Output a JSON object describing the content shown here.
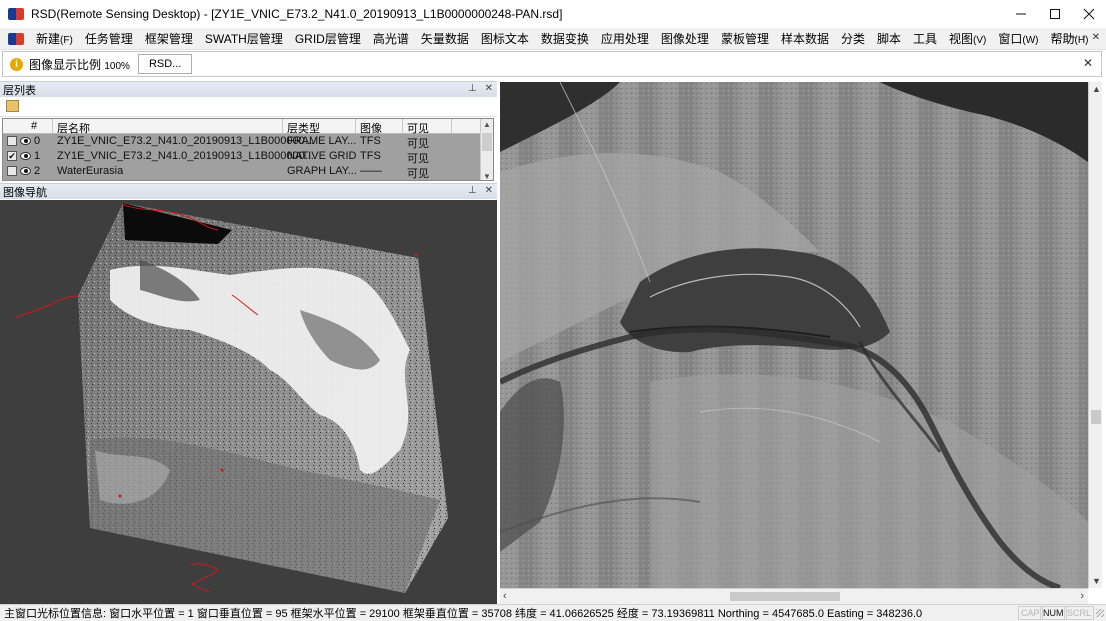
{
  "window": {
    "title": "RSD(Remote Sensing Desktop) - [ZY1E_VNIC_E73.2_N41.0_20190913_L1B0000000248-PAN.rsd]",
    "controls": [
      "minimize-icon",
      "maximize-icon",
      "close-icon"
    ]
  },
  "menubar": {
    "items": [
      {
        "label": "新建",
        "accel": "(F)"
      },
      {
        "label": "任务管理",
        "accel": ""
      },
      {
        "label": "框架管理",
        "accel": ""
      },
      {
        "label": "SWATH层管理",
        "accel": ""
      },
      {
        "label": "GRID层管理",
        "accel": ""
      },
      {
        "label": "高光谱",
        "accel": ""
      },
      {
        "label": "矢量数据",
        "accel": ""
      },
      {
        "label": "图标文本",
        "accel": ""
      },
      {
        "label": "数据变换",
        "accel": ""
      },
      {
        "label": "应用处理",
        "accel": ""
      },
      {
        "label": "图像处理",
        "accel": ""
      },
      {
        "label": "蒙板管理",
        "accel": ""
      },
      {
        "label": "样本数据",
        "accel": ""
      },
      {
        "label": "分类",
        "accel": ""
      },
      {
        "label": "脚本",
        "accel": ""
      },
      {
        "label": "工具",
        "accel": ""
      },
      {
        "label": "视图",
        "accel": "(V)"
      },
      {
        "label": "窗口",
        "accel": "(W)"
      },
      {
        "label": "帮助",
        "accel": "(H)"
      }
    ]
  },
  "infobar": {
    "label": "图像显示比例",
    "value": "100%",
    "button": "RSD..."
  },
  "layer_panel": {
    "title": "层列表",
    "columns": [
      "#",
      "层名称",
      "层类型",
      "图像",
      "可见"
    ],
    "rows": [
      {
        "index": "0",
        "checked": false,
        "name": "ZY1E_VNIC_E73.2_N41.0_20190913_L1B000000...",
        "type": "FRAME LAY...",
        "image": "TFS",
        "visible": "可见"
      },
      {
        "index": "1",
        "checked": true,
        "name": "ZY1E_VNIC_E73.2_N41.0_20190913_L1B000000...",
        "type": "NATIVE GRID",
        "image": "TFS",
        "visible": "可见"
      },
      {
        "index": "2",
        "checked": false,
        "name": "WaterEurasia",
        "type": "GRAPH LAY...",
        "image": "——",
        "visible": "可见"
      }
    ]
  },
  "nav_panel": {
    "title": "图像导航"
  },
  "statusbar": {
    "message": "主窗口光标位置信息:  窗口水平位置 = 1 窗口垂直位置 = 95 框架水平位置 = 29100 框架垂直位置 = 35708 纬度  = 41.06626525 经度  = 73.19369811 Northing = 4547685.0 Easting = 348236.0",
    "indicators": [
      "CAP",
      "NUM",
      "SCRL"
    ]
  },
  "colors": {
    "panel_header": "#dde3ec",
    "nav_background": "#3e3e3e",
    "outline_red": "#d01818"
  }
}
